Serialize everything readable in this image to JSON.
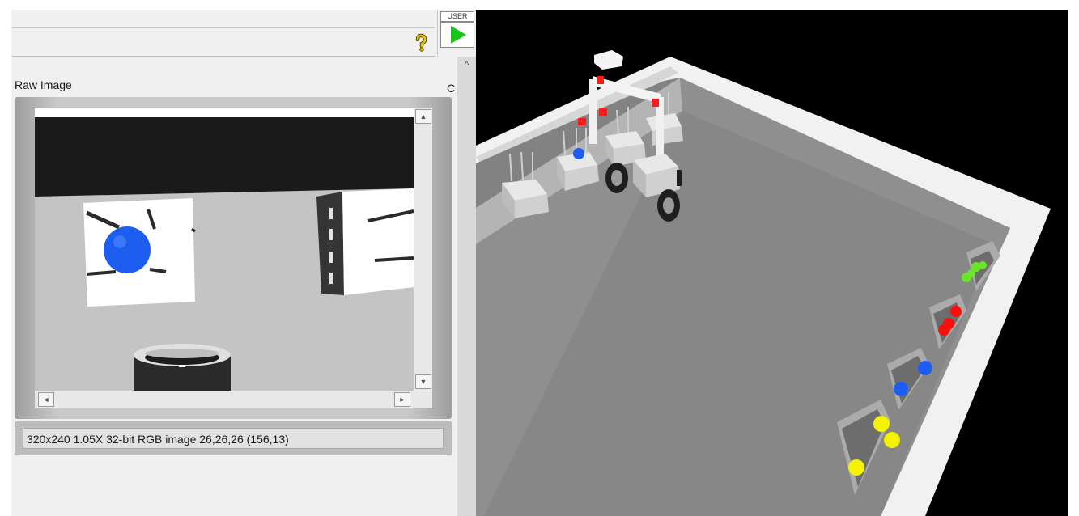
{
  "toolbar": {
    "help_icon": "question-mark-icon",
    "user_label": "USER",
    "run_icon": "play-icon",
    "scroll_up_icon": "caret-up-icon"
  },
  "viewer": {
    "title": "Raw Image",
    "clipped_label": "C",
    "status": "320x240 1.05X 32-bit RGB image 26,26,26    (156,13)",
    "scroll_up": "▲",
    "scroll_down": "▼",
    "scroll_left": "◄",
    "scroll_right": "►"
  },
  "simulation": {
    "bins": [
      "green",
      "red",
      "blue",
      "yellow"
    ]
  },
  "colors": {
    "run_green": "#19c519",
    "help_yellow": "#e8c400",
    "ball_blue": "#1d5df0",
    "ball_red": "#ff0d0d",
    "ball_green": "#6be52a",
    "ball_yellow": "#f3f300"
  }
}
